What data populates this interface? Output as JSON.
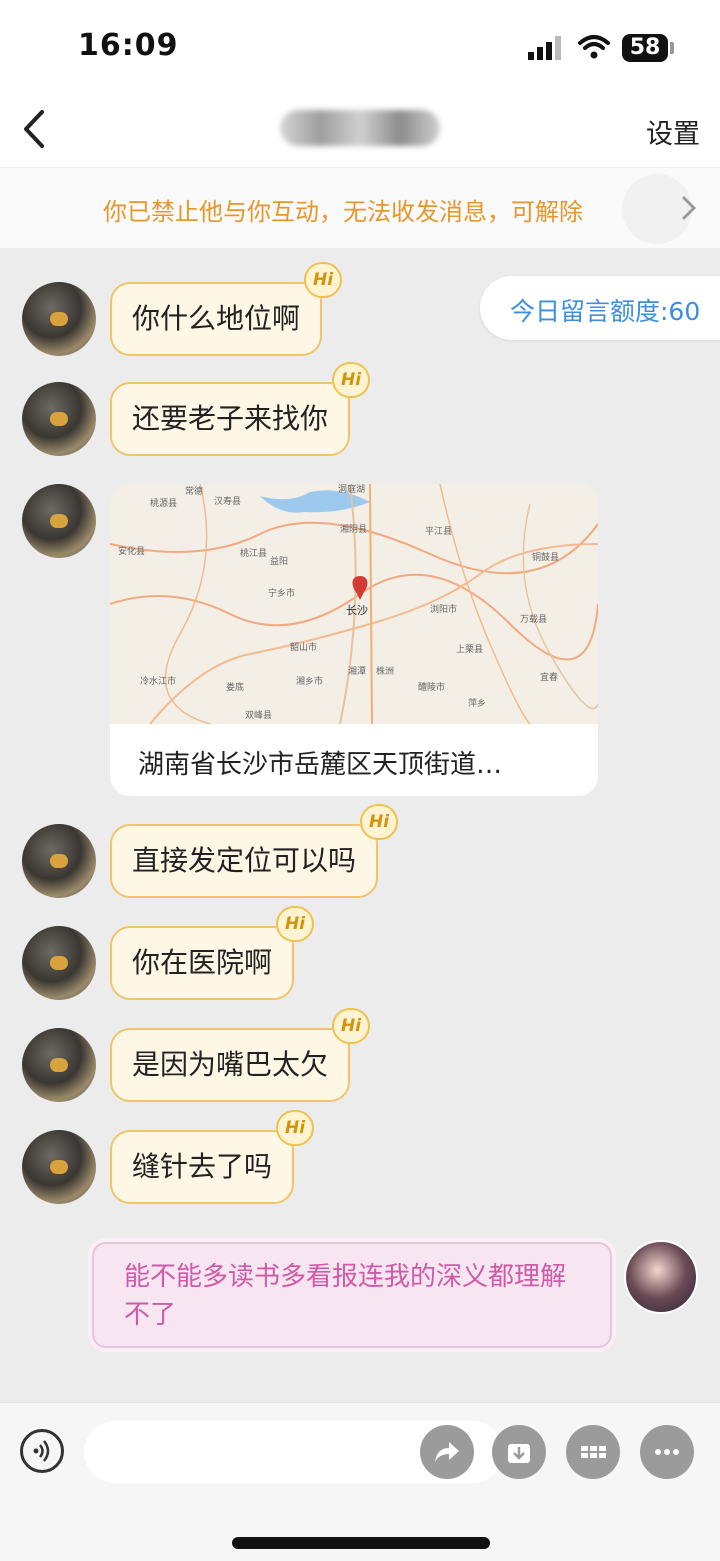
{
  "status_bar": {
    "time": "16:09",
    "battery": "58"
  },
  "nav": {
    "settings_label": "设置"
  },
  "banner": {
    "text": "你已禁止他与你互动，无法收发消息，可解除"
  },
  "quota": {
    "label": "今日留言额度:60"
  },
  "badge_label": "Hi",
  "messages": [
    {
      "text": "你什么地位啊"
    },
    {
      "text": "还要老子来找你"
    },
    {
      "text": "直接发定位可以吗"
    },
    {
      "text": "你在医院啊"
    },
    {
      "text": "是因为嘴巴太欠"
    },
    {
      "text": "缝针去了吗"
    }
  ],
  "location": {
    "address": "湖南省长沙市岳麓区天顶街道…",
    "map_labels": [
      "常德",
      "汉寿县",
      "洞庭湖",
      "湘阴县",
      "平江县",
      "益阳",
      "桃江县",
      "宁乡市",
      "长沙",
      "浏阳市",
      "韶山市",
      "湘潭",
      "株洲",
      "醴陵市",
      "娄底",
      "萍乡",
      "宜春",
      "冷水江市",
      "双峰县",
      "湘乡市",
      "万载县",
      "上栗县",
      "铜鼓县",
      "安化县",
      "桃源县"
    ]
  },
  "my_message": {
    "text": "能不能多读书多看报连我的深义都理解不了"
  }
}
